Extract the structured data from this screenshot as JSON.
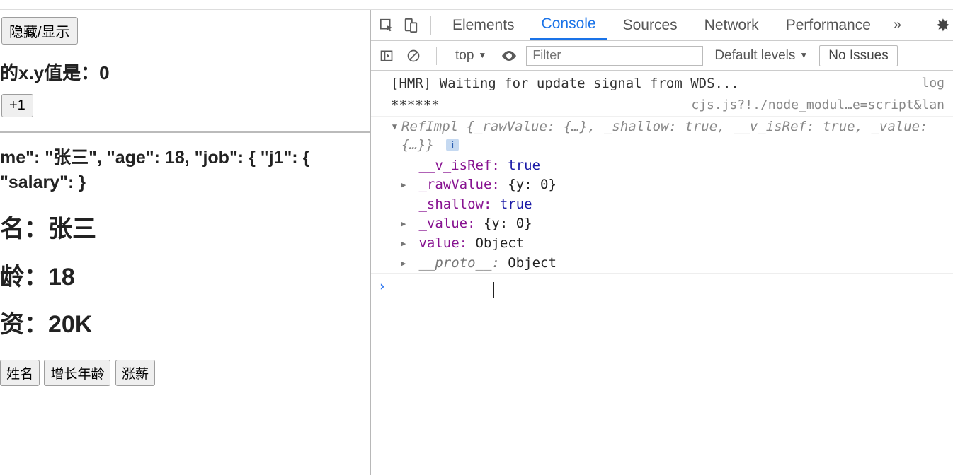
{
  "page": {
    "toggle_button": "隐藏/显示",
    "xy_line": "的x.y值是：0",
    "plus_button": "+1",
    "json_text": "me\": \"张三\", \"age\": 18, \"job\": { \"j1\": { \"salary\": }",
    "name_line": "名：张三",
    "age_line": "龄：18",
    "salary_line": "资：20K",
    "btn_name": "姓名",
    "btn_age": "增长年龄",
    "btn_salary": "涨薪"
  },
  "devtools": {
    "tabs": {
      "elements": "Elements",
      "console": "Console",
      "sources": "Sources",
      "network": "Network",
      "performance": "Performance"
    },
    "toolbar": {
      "context": "top",
      "filter_placeholder": "Filter",
      "levels": "Default levels",
      "issues": "No Issues"
    },
    "log": {
      "hmr": "[HMR] Waiting for update signal from WDS...",
      "hmr_src": "log",
      "stars": "******",
      "stars_src": "cjs.js?!./node_modul…e=script&lan",
      "ref_summary_prefix": "RefImpl",
      "ref_summary_body": "{_rawValue: {…}, _shallow: true, __v_isRef: true, _value: {…}}",
      "props": {
        "v_isRef_k": "__v_isRef",
        "v_isRef_v": "true",
        "rawValue_k": "_rawValue",
        "rawValue_v": "{y: 0}",
        "shallow_k": "_shallow",
        "shallow_v": "true",
        "value_k": "_value",
        "value_v": "{y: 0}",
        "value2_k": "value",
        "value2_v": "Object",
        "proto_k": "__proto__",
        "proto_v": "Object"
      }
    }
  }
}
